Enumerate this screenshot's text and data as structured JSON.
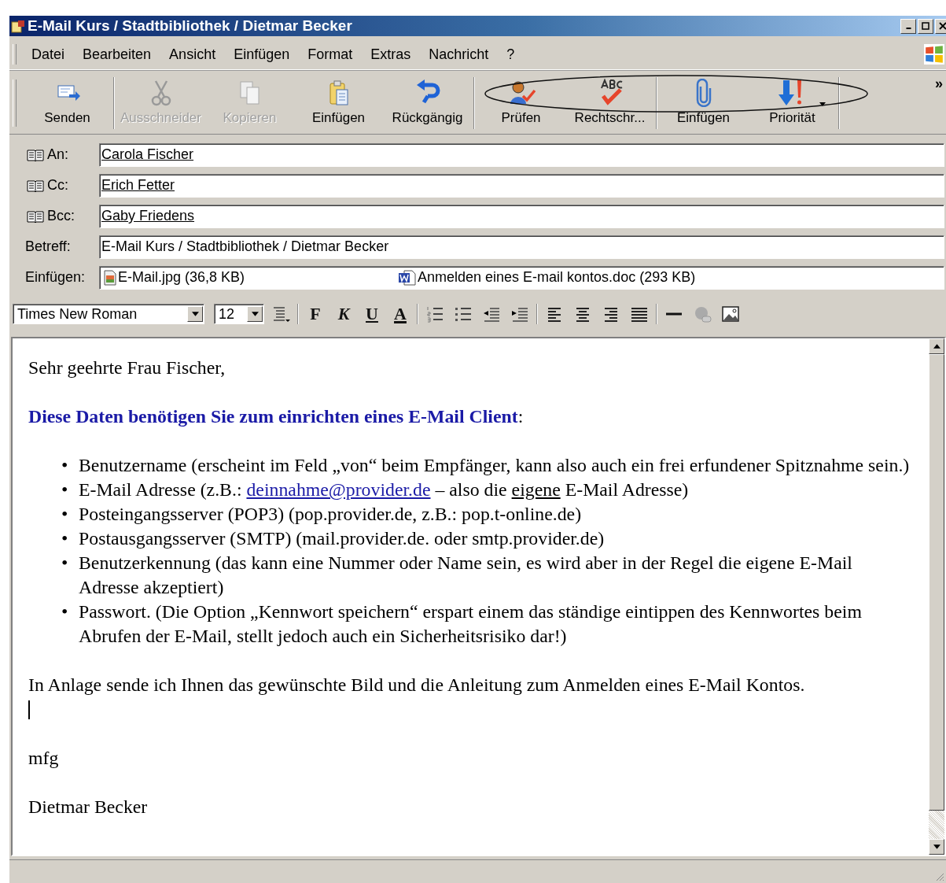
{
  "window": {
    "title": "E-Mail Kurs / Stadtbibliothek / Dietmar Becker"
  },
  "menu": [
    "Datei",
    "Bearbeiten",
    "Ansicht",
    "Einfügen",
    "Format",
    "Extras",
    "Nachricht",
    "?"
  ],
  "toolbar_groups": [
    [
      {
        "label": "Senden",
        "disabled": false
      }
    ],
    [
      {
        "label": "Ausschneider",
        "disabled": true
      },
      {
        "label": "Kopieren",
        "disabled": true
      },
      {
        "label": "Einfügen",
        "disabled": false
      },
      {
        "label": "Rückgängig",
        "disabled": false
      }
    ],
    [
      {
        "label": "Prüfen",
        "disabled": false
      },
      {
        "label": "Rechtschr...",
        "disabled": false
      }
    ],
    [
      {
        "label": "Einfügen",
        "disabled": false
      },
      {
        "label": "Priorität",
        "disabled": false,
        "dropdown": true
      }
    ]
  ],
  "toolbar_more": "»",
  "fields": [
    {
      "kind": "address",
      "label": "An:",
      "value": "Carola Fischer"
    },
    {
      "kind": "address",
      "label": "Cc:",
      "value": "Erich Fetter"
    },
    {
      "kind": "address",
      "label": "Bcc:",
      "value": "Gaby Friedens"
    },
    {
      "kind": "text",
      "label": "Betreff:",
      "value": "E-Mail Kurs / Stadtbibliothek / Dietmar Becker"
    }
  ],
  "attachments": {
    "label": "Einfügen:",
    "files": [
      {
        "kind": "image",
        "name": "E-Mail.jpg (36,8 KB)"
      },
      {
        "kind": "word",
        "name": "Anmelden eines E-mail kontos.doc (293 KB)"
      }
    ]
  },
  "format_bar": {
    "font": "Times New Roman",
    "size": "12",
    "text_buttons": [
      "F",
      "K",
      "U",
      "A"
    ]
  },
  "body": {
    "greeting": "Sehr geehrte Frau Fischer,",
    "heading": [
      {
        "kind": "heading",
        "text": "Diese Daten benötigen Sie zum einrichten eines E-Mail Client"
      },
      {
        "kind": "plain",
        "text": ":"
      }
    ],
    "bullets": [
      {
        "marker": "•",
        "parts": [
          {
            "kind": "plain",
            "text": "Benutzername (erscheint im Feld „von“ beim Empfänger, kann also auch ein frei erfundener Spitznahme sein.)"
          }
        ]
      },
      {
        "marker": "•",
        "parts": [
          {
            "kind": "plain",
            "text": "E-Mail Adresse (z.B.: "
          },
          {
            "kind": "link",
            "text": "deinnahme@provider.de"
          },
          {
            "kind": "plain",
            "text": " – also die "
          },
          {
            "kind": "underline",
            "text": "eigene"
          },
          {
            "kind": "plain",
            "text": " E-Mail Adresse)"
          }
        ]
      },
      {
        "marker": "•",
        "parts": [
          {
            "kind": "plain",
            "text": "Posteingangsserver (POP3) (pop.provider.de, z.B.: pop.t-online.de)"
          }
        ]
      },
      {
        "marker": "•",
        "parts": [
          {
            "kind": "plain",
            "text": "Postausgangsserver (SMTP) (mail.provider.de. oder smtp.provider.de)"
          }
        ]
      },
      {
        "marker": "•",
        "parts": [
          {
            "kind": "plain",
            "text": "Benutzerkennung (das kann eine Nummer oder Name sein, es wird aber in der Regel die eigene E-Mail Adresse akzeptiert)"
          }
        ]
      },
      {
        "marker": "•",
        "parts": [
          {
            "kind": "plain",
            "text": "Passwort. (Die Option „Kennwort speichern“ erspart einem das ständige eintippen des Kennwortes beim Abrufen der E-Mail, stellt jedoch auch ein Sicherheitsrisiko dar!)"
          }
        ]
      }
    ],
    "closing": "In Anlage sende ich Ihnen das gewünschte Bild und die Anleitung zum Anmelden eines E-Mail Kontos.",
    "sign_off": "mfg",
    "signature": "Dietmar Becker"
  }
}
